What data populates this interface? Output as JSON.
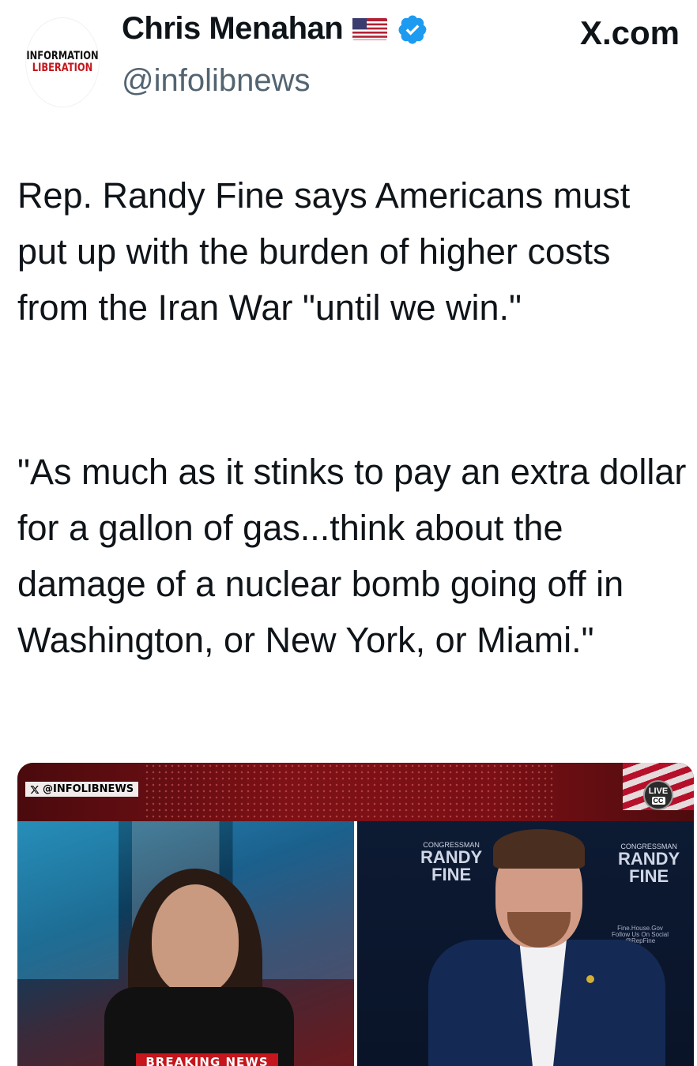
{
  "author": {
    "avatar_line1": "INFORMATION",
    "avatar_line2": "LIBERATION",
    "display_name": "Chris Menahan",
    "handle": "@infolibnews"
  },
  "source_label": "X.com",
  "post": {
    "paragraph1": "Rep. Randy Fine says Americans must put up with the burden of higher costs from the Iran War \"until we win.\"",
    "paragraph2": "\"As much as it stinks to pay an extra dollar for a gallon of gas...think about the damage of a nuclear bomb going off in Washington, or New York, or Miami.\""
  },
  "video": {
    "watermark": "@INFOLIBNEWS",
    "live_label": "LIVE",
    "cc_label": "CC",
    "chyron": "BREAKING NEWS",
    "backdrop": {
      "congressman": "CONGRESSMAN",
      "randy": "RANDY",
      "fine": "FINE",
      "follow": "Follow Us On Social",
      "site": "Fine.House.Gov",
      "tag": "@RepFine"
    }
  },
  "colors": {
    "verified": "#1d9bf0",
    "handle": "#536471",
    "text": "#0f1419",
    "accent_red": "#c4161c"
  },
  "icons": [
    "us-flag-icon",
    "verified-badge-icon",
    "x-logo-icon"
  ]
}
